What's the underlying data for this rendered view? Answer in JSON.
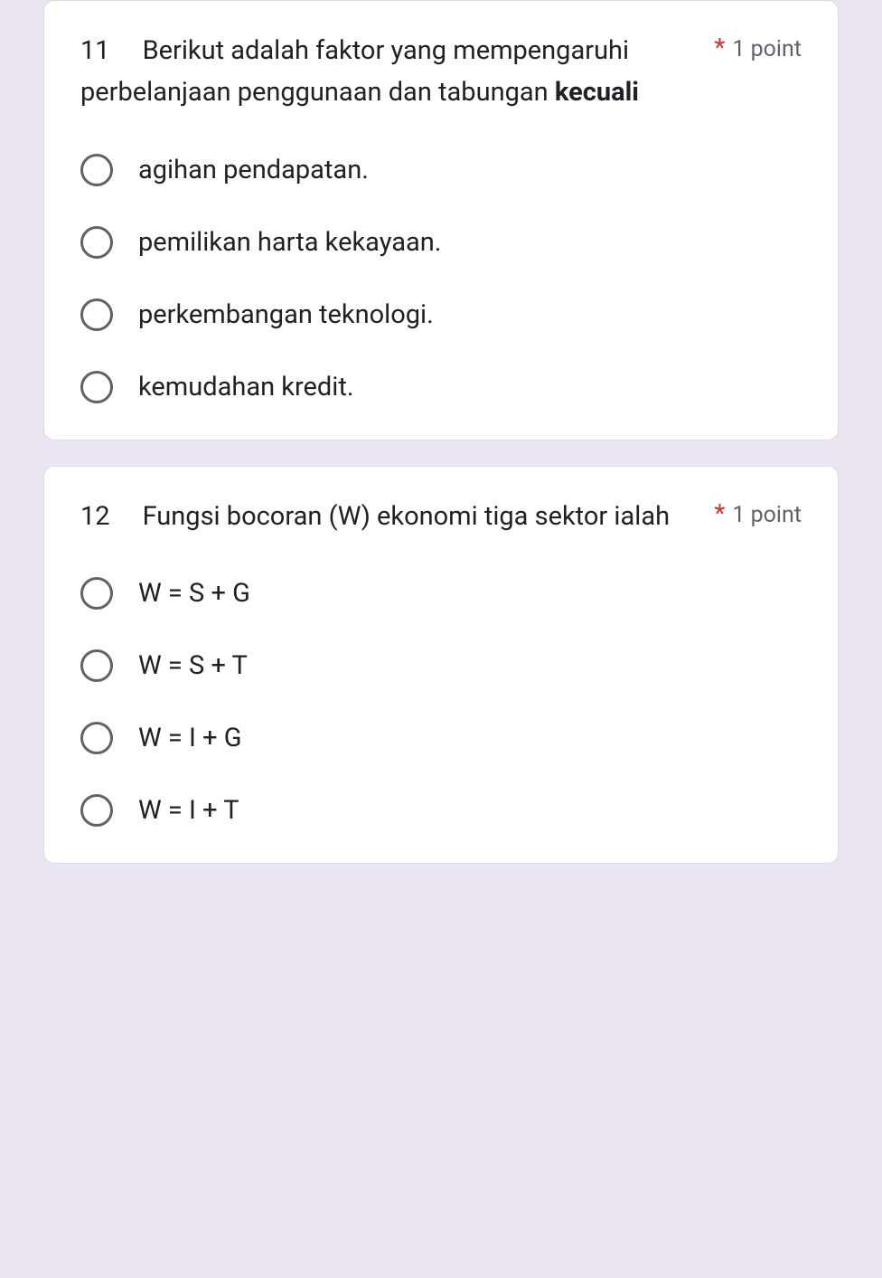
{
  "questions": [
    {
      "number": "11",
      "text_pre": "Berikut adalah faktor yang mempengaruhi perbelanjaan penggunaan dan tabungan ",
      "text_bold": "kecuali",
      "required_mark": "*",
      "points": "1 point",
      "options": [
        "agihan pendapatan.",
        "pemilikan harta kekayaan.",
        "perkembangan teknologi.",
        "kemudahan kredit."
      ]
    },
    {
      "number": "12",
      "text_pre": "Fungsi bocoran (W) ekonomi tiga sektor ialah",
      "text_bold": "",
      "required_mark": "*",
      "points": "1 point",
      "options": [
        "W = S + G",
        "W = S + T",
        "W = I + G",
        "W = I + T"
      ]
    }
  ]
}
